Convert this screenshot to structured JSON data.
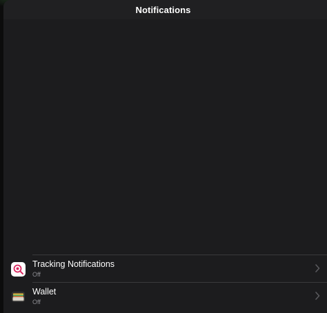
{
  "navbar": {
    "title": "Notifications"
  },
  "apps": [
    {
      "name": "Tracking Notifications",
      "status": "Off",
      "icon": "tracking-magnifier-icon"
    },
    {
      "name": "Wallet",
      "status": "Off",
      "icon": "wallet-icon"
    }
  ],
  "colors": {
    "background": "#1c1c1e",
    "separator": "#3a3a3c",
    "secondary_text": "#8e8e93",
    "tracking_icon_accent": "#d9265f"
  }
}
